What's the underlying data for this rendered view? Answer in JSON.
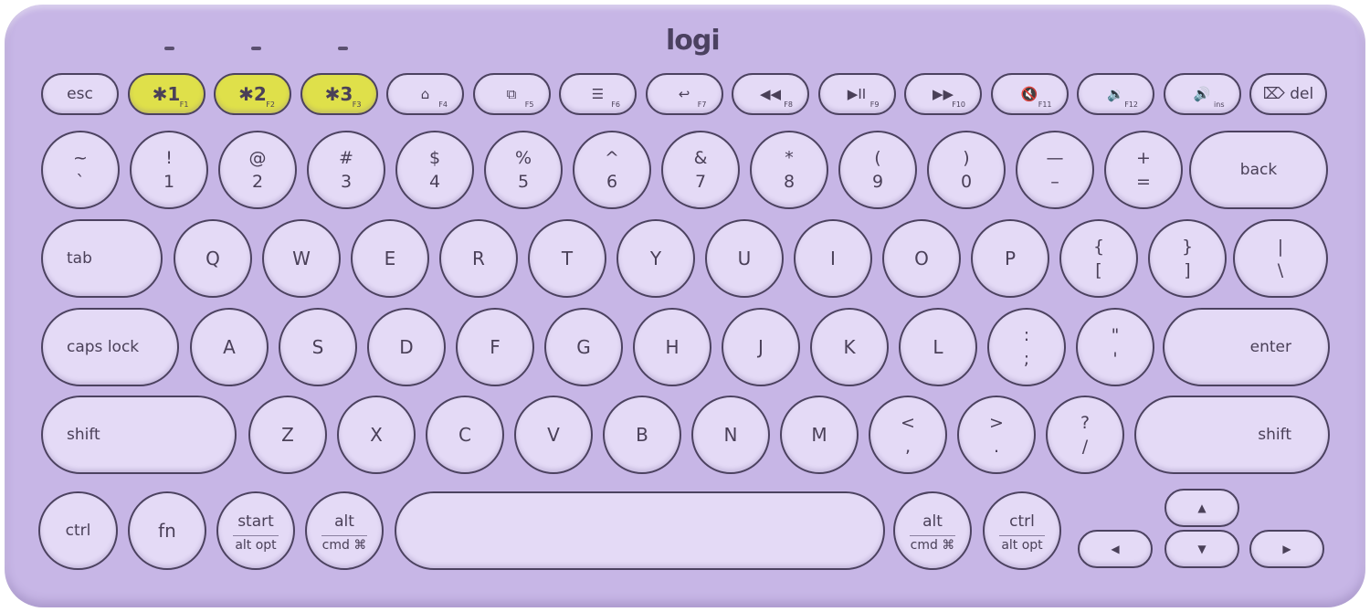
{
  "brand": "logi",
  "colors": {
    "body": "#c7b6e6",
    "key": "#e4daf6",
    "easy_switch": "#dfe04a",
    "outline": "#4c4260"
  },
  "function_row": [
    {
      "label": "esc"
    },
    {
      "label": "✱1",
      "fn": "F1",
      "highlight": true
    },
    {
      "label": "✱2",
      "fn": "F2",
      "highlight": true
    },
    {
      "label": "✱3",
      "fn": "F3",
      "highlight": true
    },
    {
      "label": "⌂",
      "fn": "F4",
      "icon": "home-icon"
    },
    {
      "label": "⧉",
      "fn": "F5",
      "icon": "app-switch-icon"
    },
    {
      "label": "☰",
      "fn": "F6",
      "icon": "menu-icon"
    },
    {
      "label": "↩",
      "fn": "F7",
      "icon": "back-icon"
    },
    {
      "label": "◀◀",
      "fn": "F8",
      "icon": "rewind-icon"
    },
    {
      "label": "▶II",
      "fn": "F9",
      "icon": "play-pause-icon"
    },
    {
      "label": "▶▶",
      "fn": "F10",
      "icon": "fast-forward-icon"
    },
    {
      "label": "🔇",
      "fn": "F11",
      "icon": "mute-icon"
    },
    {
      "label": "🔉",
      "fn": "F12",
      "icon": "volume-down-icon"
    },
    {
      "label": "🔊",
      "fn": "ins",
      "icon": "volume-up-icon"
    },
    {
      "label": "⌦ del"
    }
  ],
  "number_row": [
    {
      "top": "~",
      "bottom": "`"
    },
    {
      "top": "!",
      "bottom": "1"
    },
    {
      "top": "@",
      "bottom": "2"
    },
    {
      "top": "#",
      "bottom": "3"
    },
    {
      "top": "$",
      "bottom": "4"
    },
    {
      "top": "%",
      "bottom": "5"
    },
    {
      "top": "^",
      "bottom": "6"
    },
    {
      "top": "&",
      "bottom": "7"
    },
    {
      "top": "*",
      "bottom": "8"
    },
    {
      "top": "(",
      "bottom": "9"
    },
    {
      "top": ")",
      "bottom": "0"
    },
    {
      "top": "—",
      "bottom": "–"
    },
    {
      "top": "+",
      "bottom": "="
    },
    {
      "label": "back"
    }
  ],
  "top_row": [
    {
      "label": "tab"
    },
    {
      "label": "Q"
    },
    {
      "label": "W"
    },
    {
      "label": "E"
    },
    {
      "label": "R"
    },
    {
      "label": "T"
    },
    {
      "label": "Y"
    },
    {
      "label": "U"
    },
    {
      "label": "I"
    },
    {
      "label": "O"
    },
    {
      "label": "P"
    },
    {
      "top": "{",
      "bottom": "["
    },
    {
      "top": "}",
      "bottom": "]"
    },
    {
      "top": "|",
      "bottom": "\\"
    }
  ],
  "home_row": [
    {
      "label": "caps lock"
    },
    {
      "label": "A"
    },
    {
      "label": "S"
    },
    {
      "label": "D"
    },
    {
      "label": "F"
    },
    {
      "label": "G"
    },
    {
      "label": "H"
    },
    {
      "label": "J"
    },
    {
      "label": "K"
    },
    {
      "label": "L"
    },
    {
      "top": ":",
      "bottom": ";"
    },
    {
      "top": "\"",
      "bottom": "'"
    },
    {
      "label": "enter"
    }
  ],
  "bottom_row": [
    {
      "label": "shift"
    },
    {
      "label": "Z"
    },
    {
      "label": "X"
    },
    {
      "label": "C"
    },
    {
      "label": "V"
    },
    {
      "label": "B"
    },
    {
      "label": "N"
    },
    {
      "label": "M"
    },
    {
      "top": "<",
      "bottom": ","
    },
    {
      "top": ">",
      "bottom": "."
    },
    {
      "top": "?",
      "bottom": "/"
    },
    {
      "label": "shift"
    }
  ],
  "modifier_row": [
    {
      "label": "ctrl"
    },
    {
      "label": "fn"
    },
    {
      "top": "start",
      "bottom": "alt opt"
    },
    {
      "top": "alt",
      "bottom": "cmd ⌘"
    },
    {
      "label": ""
    },
    {
      "top": "alt",
      "bottom": "cmd ⌘"
    },
    {
      "top": "ctrl",
      "bottom": "alt opt"
    }
  ],
  "arrows": [
    {
      "label": "▲",
      "name": "up"
    },
    {
      "label": "◀",
      "name": "left"
    },
    {
      "label": "▼",
      "name": "down"
    },
    {
      "label": "▶",
      "name": "right"
    }
  ]
}
